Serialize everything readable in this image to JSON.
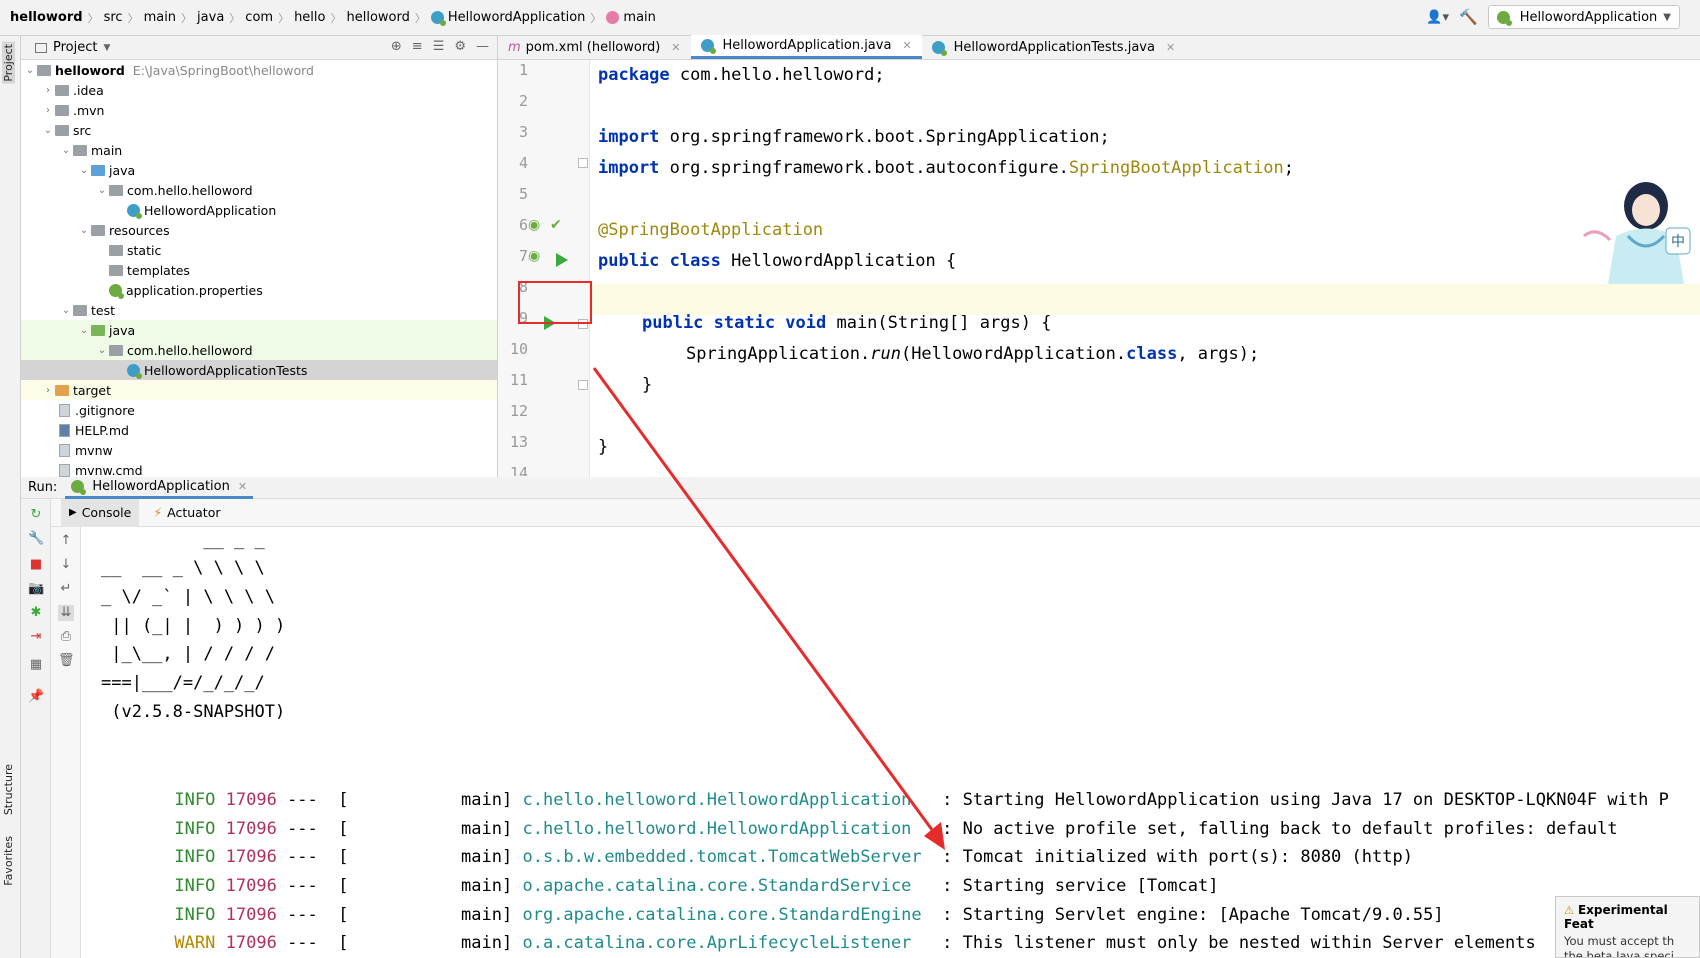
{
  "breadcrumb": {
    "items": [
      "helloword",
      "src",
      "main",
      "java",
      "com",
      "hello",
      "helloword",
      "HellowordApplication",
      "main"
    ]
  },
  "toolbar": {
    "run_config": "HellowordApplication"
  },
  "left_strip": {
    "project_tab": "Project",
    "structure_tab": "Structure",
    "favorites_tab": "Favorites"
  },
  "project": {
    "header": "Project",
    "tree": [
      {
        "label": "helloword",
        "path": "E:\\Java\\SpringBoot\\helloword"
      },
      {
        "label": ".idea"
      },
      {
        "label": ".mvn"
      },
      {
        "label": "src"
      },
      {
        "label": "main"
      },
      {
        "label": "java"
      },
      {
        "label": "com.hello.helloword"
      },
      {
        "label": "HellowordApplication"
      },
      {
        "label": "resources"
      },
      {
        "label": "static"
      },
      {
        "label": "templates"
      },
      {
        "label": "application.properties"
      },
      {
        "label": "test"
      },
      {
        "label": "java"
      },
      {
        "label": "com.hello.helloword"
      },
      {
        "label": "HellowordApplicationTests"
      },
      {
        "label": "target"
      },
      {
        "label": ".gitignore"
      },
      {
        "label": "HELP.md"
      },
      {
        "label": "mvnw"
      },
      {
        "label": "mvnw.cmd"
      }
    ]
  },
  "editor": {
    "tabs": [
      {
        "label": "pom.xml (helloword)"
      },
      {
        "label": "HellowordApplication.java"
      },
      {
        "label": "HellowordApplicationTests.java"
      }
    ],
    "line_numbers": [
      "1",
      "2",
      "3",
      "4",
      "5",
      "6",
      "7",
      "8",
      "9",
      "10",
      "11",
      "12",
      "13",
      "14"
    ],
    "lines": {
      "l1_kw": "package",
      "l1_rest": " com.hello.helloword;",
      "l3_kw": "import",
      "l3_rest": " org.springframework.boot.SpringApplication;",
      "l4_kw": "import",
      "l4_rest": " org.springframework.boot.autoconfigure.",
      "l4_ann": "SpringBootApplication",
      "l4_end": ";",
      "l6_ann": "@SpringBootApplication",
      "l7_kw": "public class",
      "l7_rest": " HellowordApplication {",
      "l9_kw": "public static void",
      "l9_rest": " main(String[] args) {",
      "l10_a": "SpringApplication.",
      "l10_run": "run",
      "l10_b": "(HellowordApplication.",
      "l10_kw": "class",
      "l10_c": ", args);",
      "l11": "}",
      "l13": "}"
    }
  },
  "run": {
    "label": "Run:",
    "tab": "HellowordApplication",
    "subtabs": [
      "Console",
      "Actuator"
    ],
    "banner": [
      "          __ _ _",
      "__  __ _ \\ \\ \\ \\",
      "_ \\/ _` | \\ \\ \\ \\",
      " || (_| |  ) ) ) )",
      " |_\\__, | / / / /",
      "===|___/=/_/_/_/",
      " (v2.5.8-SNAPSHOT)"
    ],
    "logs": [
      {
        "level": "INFO",
        "pid": "17096",
        "thread": "---  [           main]",
        "logger": "c.hello.helloword.HellowordApplication  ",
        "msg": " : Starting HellowordApplication using Java 17 on DESKTOP-LQKN04F with P"
      },
      {
        "level": "INFO",
        "pid": "17096",
        "thread": "---  [           main]",
        "logger": "c.hello.helloword.HellowordApplication  ",
        "msg": " : No active profile set, falling back to default profiles: default"
      },
      {
        "level": "INFO",
        "pid": "17096",
        "thread": "---  [           main]",
        "logger": "o.s.b.w.embedded.tomcat.TomcatWebServer ",
        "msg": " : Tomcat initialized with port(s): 8080 (http)"
      },
      {
        "level": "INFO",
        "pid": "17096",
        "thread": "---  [           main]",
        "logger": "o.apache.catalina.core.StandardService  ",
        "msg": " : Starting service [Tomcat]"
      },
      {
        "level": "INFO",
        "pid": "17096",
        "thread": "---  [           main]",
        "logger": "org.apache.catalina.core.StandardEngine ",
        "msg": " : Starting Servlet engine: [Apache Tomcat/9.0.55]"
      },
      {
        "level": "WARN",
        "pid": "17096",
        "thread": "---  [           main]",
        "logger": "o.a.catalina.core.AprLifecycleListener  ",
        "msg": " : This listener must only be nested within Server elements"
      }
    ]
  },
  "notification": {
    "title": "Experimental Feat",
    "body": "You must accept th the beta Java speci"
  },
  "colors": {
    "accent": "#4a88c7",
    "annotation_red": "#e62b2b",
    "run_green": "#3ba93b"
  }
}
